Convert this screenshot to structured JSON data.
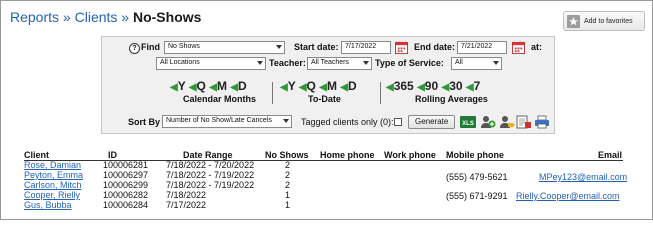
{
  "breadcrumb": {
    "reports": "Reports",
    "sep1": "»",
    "clients": "Clients",
    "sep2": "»",
    "current": "No-Shows"
  },
  "favorites_button": {
    "label": "Add to favorites",
    "icon": "star-icon"
  },
  "filters": {
    "find_label": "Find",
    "find_value": "No Shows",
    "start_date_label": "Start date:",
    "start_date_value": "7/17/2022",
    "end_date_label": "End date:",
    "end_date_value": "7/21/2022",
    "at_label": "at:",
    "location_value": "All Locations",
    "teacher_label": "Teacher:",
    "teacher_value": "All Teachers",
    "service_label": "Type of Service:",
    "service_value": "All"
  },
  "date_nav": {
    "calendar": {
      "buttons": [
        "Y",
        "Q",
        "M",
        "D"
      ],
      "caption": "Calendar Months"
    },
    "todate": {
      "buttons": [
        "Y",
        "Q",
        "M",
        "D"
      ],
      "caption": "To-Date"
    },
    "rolling": {
      "buttons": [
        "365",
        "90",
        "30",
        "7"
      ],
      "caption": "Rolling Averages"
    },
    "arrow_color": "#2f9a35"
  },
  "sort": {
    "label": "Sort By",
    "value": "Number of No Show/Late Cancels",
    "tagged_label": "Tagged clients only (0):",
    "generate_label": "Generate"
  },
  "toolbar_icons": [
    "excel-icon",
    "user-add-icon",
    "user-tag-icon",
    "print-icon",
    "printer-icon"
  ],
  "table": {
    "headers": {
      "client": "Client",
      "id": "ID",
      "date_range": "Date Range",
      "no_shows": "No Shows",
      "home_phone": "Home phone",
      "work_phone": "Work phone",
      "mobile_phone": "Mobile phone",
      "email": "Email"
    },
    "rows": [
      {
        "client": "Rose, Damian",
        "id": "100006281",
        "date_range": "7/18/2022 - 7/20/2022",
        "no_shows": "2",
        "home_phone": "",
        "work_phone": "",
        "mobile_phone": "",
        "email": ""
      },
      {
        "client": "Peyton, Emma",
        "id": "100006297",
        "date_range": "7/18/2022 - 7/19/2022",
        "no_shows": "2",
        "home_phone": "",
        "work_phone": "",
        "mobile_phone": "(555) 479-5621",
        "email": "MPey123@email.com"
      },
      {
        "client": "Carlson, Mitch",
        "id": "100006299",
        "date_range": "7/18/2022 - 7/19/2022",
        "no_shows": "2",
        "home_phone": "",
        "work_phone": "",
        "mobile_phone": "",
        "email": ""
      },
      {
        "client": "Cooper, Rielly",
        "id": "100006282",
        "date_range": "7/18/2022",
        "no_shows": "1",
        "home_phone": "",
        "work_phone": "",
        "mobile_phone": "(555) 671-9291",
        "email": "Rielly.Cooper@email.com"
      },
      {
        "client": "Gus, Bubba",
        "id": "100006284",
        "date_range": "7/17/2022",
        "no_shows": "1",
        "home_phone": "",
        "work_phone": "",
        "mobile_phone": "",
        "email": ""
      }
    ]
  }
}
